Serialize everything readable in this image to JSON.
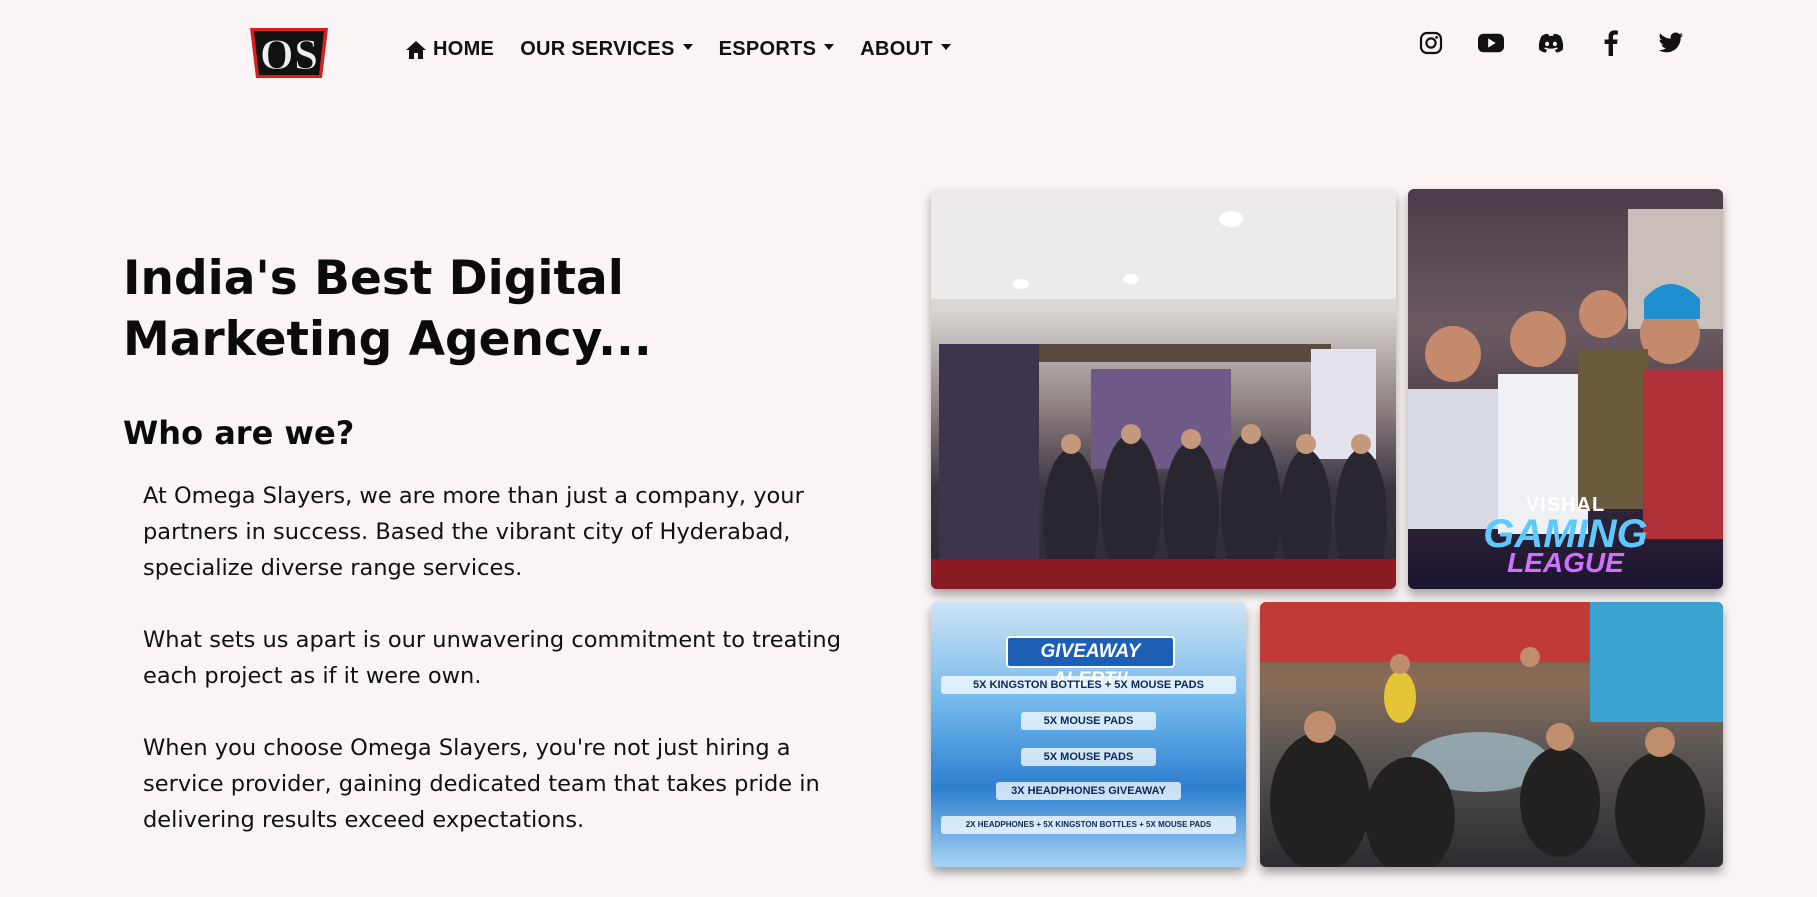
{
  "logo": {
    "text": "OS",
    "alt": "OS logo"
  },
  "nav": {
    "home_label": "HOME",
    "services_label": "OUR SERVICES",
    "esports_label": "ESPORTS",
    "about_label": "ABOUT"
  },
  "socials": [
    "instagram-icon",
    "youtube-icon",
    "discord-icon",
    "facebook-icon",
    "twitter-icon"
  ],
  "hero": {
    "title": "India's Best Digital Marketing Agency...",
    "subtitle": "Who are we?",
    "paragraphs": [
      "At Omega Slayers, we are more than just a company, your partners in success. Based the vibrant city of Hyderabad, specialize diverse range services.",
      "What sets us apart is our unwavering commitment to treating each project as if it were own.",
      "When you choose Omega Slayers, you're not just hiring a service provider, gaining dedicated team that takes pride in delivering results exceed expectations."
    ]
  },
  "gallery": {
    "league_brand": "VISHAL",
    "league_word1": "GAMING",
    "league_word2": "LEAGUE",
    "giveaway_title": "GIVEAWAY ALERT!!",
    "giveaway_rows": [
      "5X KINGSTON BOTTLES + 5X MOUSE PADS",
      "5X MOUSE PADS",
      "5X MOUSE PADS",
      "3X HEADPHONES GIVEAWAY",
      "2X HEADPHONES + 5X KINGSTON BOTTLES + 5X MOUSE PADS"
    ]
  },
  "colors": {
    "background": "#faf5f4",
    "text": "#111111",
    "logo_red": "#d81e1e"
  }
}
